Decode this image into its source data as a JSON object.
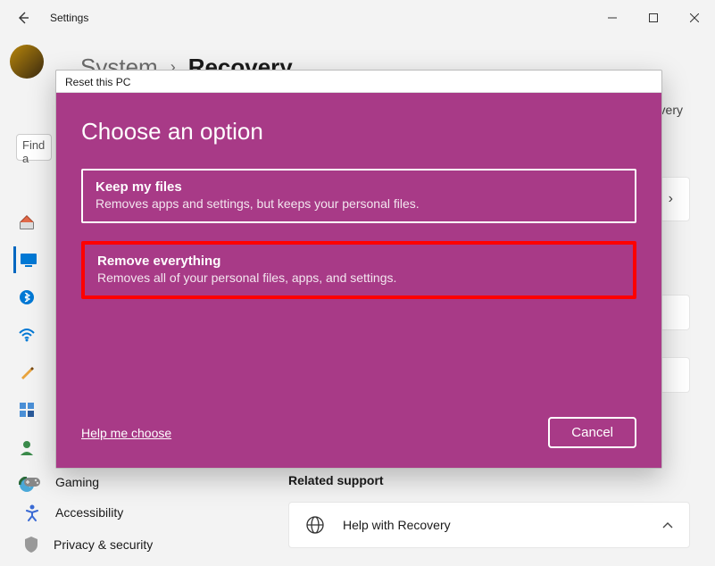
{
  "window": {
    "title": "Settings"
  },
  "breadcrumb": {
    "parent": "System",
    "current": "Recovery",
    "peek": "overy"
  },
  "search": {
    "placeholder_stub": "Find a"
  },
  "sidebar_bottom": {
    "gaming": "Gaming",
    "access": "Accessibility",
    "privacy": "Privacy & security"
  },
  "related": {
    "title": "Related support",
    "help": "Help with Recovery"
  },
  "modal": {
    "wintitle": "Reset this PC",
    "heading": "Choose an option",
    "opt1_title": "Keep my files",
    "opt1_desc": "Removes apps and settings, but keeps your personal files.",
    "opt2_title": "Remove everything",
    "opt2_desc": "Removes all of your personal files, apps, and settings.",
    "help": "Help me choose",
    "cancel": "Cancel"
  }
}
